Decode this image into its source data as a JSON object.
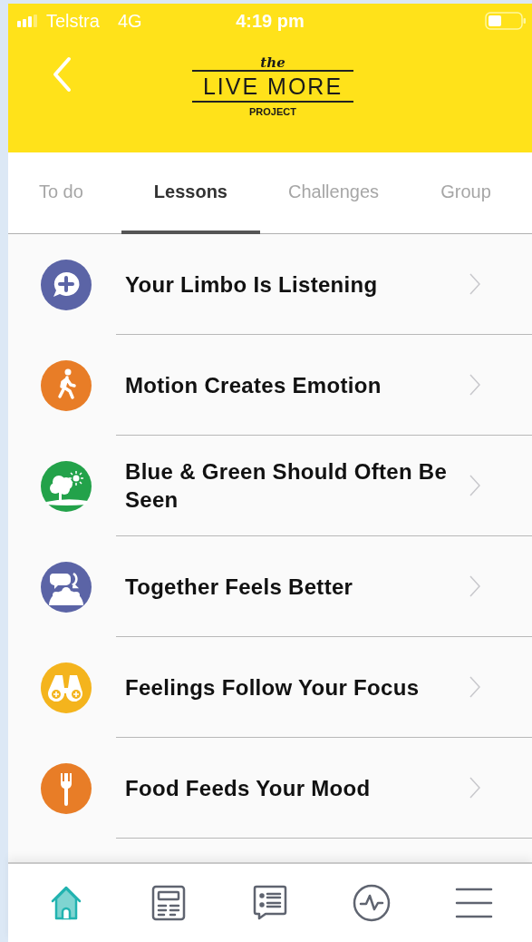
{
  "status_bar": {
    "carrier": "Telstra",
    "network": "4G",
    "time": "4:19 pm"
  },
  "header": {
    "logo": {
      "small": "the",
      "main": "LIVE MORE",
      "sub": "PROJECT"
    }
  },
  "tabs": [
    {
      "label": "To do",
      "selected": false
    },
    {
      "label": "Lessons",
      "selected": true
    },
    {
      "label": "Challenges",
      "selected": false
    },
    {
      "label": "Group",
      "selected": false
    }
  ],
  "lessons": [
    {
      "title": "Your Limbo Is Listening",
      "kind": "speech",
      "color": "#5b64a6"
    },
    {
      "title": "Motion Creates Emotion",
      "kind": "walk",
      "color": "#e87d27"
    },
    {
      "title": "Blue & Green Should Often Be Seen",
      "kind": "tree",
      "color": "#23a24a"
    },
    {
      "title": "Together Feels Better",
      "kind": "group",
      "color": "#5b64a6"
    },
    {
      "title": "Feelings Follow Your Focus",
      "kind": "binoculars",
      "color": "#f4b41d"
    },
    {
      "title": "Food Feeds Your Mood",
      "kind": "fork",
      "color": "#e87d27"
    }
  ],
  "bottom_nav": [
    {
      "kind": "home",
      "selected": true
    },
    {
      "kind": "news",
      "selected": false
    },
    {
      "kind": "chat",
      "selected": false
    },
    {
      "kind": "pulse",
      "selected": false
    },
    {
      "kind": "menu",
      "selected": false
    }
  ]
}
